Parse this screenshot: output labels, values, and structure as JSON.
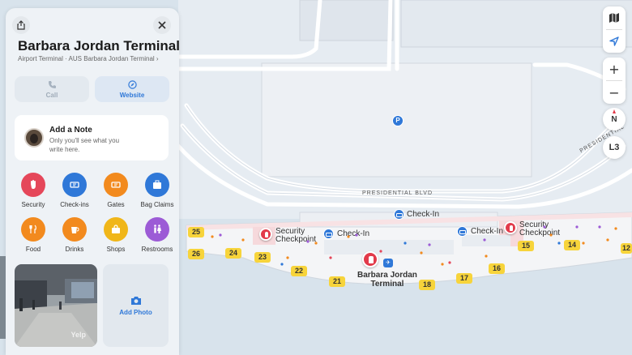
{
  "place": {
    "title": "Barbara Jordan Terminal",
    "subtitle": "Airport Terminal · AUS Barbara Jordan Terminal",
    "subtitle_chevron": "›"
  },
  "actions": {
    "call_label": "Call",
    "website_label": "Website"
  },
  "note": {
    "title": "Add a Note",
    "body_line1": "Only you'll see what you",
    "body_line2": "write here."
  },
  "categories": [
    {
      "label": "Security",
      "color": "#e5475a",
      "icon": "hand-icon"
    },
    {
      "label": "Check-ins",
      "color": "#2f78d8",
      "icon": "ticket-icon"
    },
    {
      "label": "Gates",
      "color": "#f28a1e",
      "icon": "ticket-icon"
    },
    {
      "label": "Bag Claims",
      "color": "#2f78d8",
      "icon": "suitcase-icon"
    },
    {
      "label": "Food",
      "color": "#f28a1e",
      "icon": "fork-knife-icon"
    },
    {
      "label": "Drinks",
      "color": "#f28a1e",
      "icon": "cup-icon"
    },
    {
      "label": "Shops",
      "color": "#f0b619",
      "icon": "bag-icon"
    },
    {
      "label": "Restrooms",
      "color": "#9c5bd6",
      "icon": "restroom-icon"
    }
  ],
  "photo": {
    "credit": "Yelp",
    "add_label": "Add Photo"
  },
  "map": {
    "road_presidential_blvd": "PRESIDENTIAL BLVD",
    "road_presidential_right": "PRESIDENTIAL",
    "parking_symbol": "P",
    "checkin_top": "Check-In",
    "checkin_left": "Check-In",
    "checkin_right": "Check-In",
    "security_left_line1": "Security",
    "security_left_line2": "Checkpoint",
    "security_right_line1": "Security",
    "security_right_line2": "Checkpoint",
    "terminal_line1": "Barbara Jordan",
    "terminal_line2": "Terminal",
    "gates": [
      "25",
      "26",
      "24",
      "23",
      "22",
      "21",
      "18",
      "17",
      "16",
      "15",
      "14",
      "12"
    ]
  },
  "controls": {
    "zoom_in": "+",
    "zoom_out": "−",
    "compass": "N",
    "level": "L3"
  }
}
